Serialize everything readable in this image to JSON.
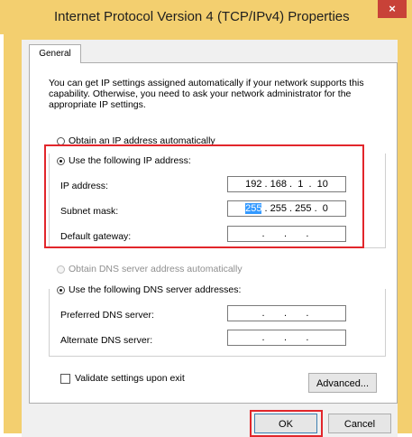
{
  "window": {
    "title": "Internet Protocol Version 4 (TCP/IPv4) Properties",
    "close_symbol": "×"
  },
  "tabs": [
    "General"
  ],
  "description": "You can get IP settings assigned automatically if your network supports this capability. Otherwise, you need to ask your network administrator for the appropriate IP settings.",
  "ip": {
    "auto_label": "Obtain an IP address automatically",
    "manual_label": "Use the following IP address:",
    "address_label": "IP address:",
    "address_value": "192 . 168 .  1  .  10",
    "mask_label": "Subnet mask:",
    "mask_selected": "255",
    "mask_rest": " . 255 . 255 .  0",
    "gateway_label": "Default gateway:",
    "gateway_value": " .       .       .  "
  },
  "dns": {
    "auto_label": "Obtain DNS server address automatically",
    "manual_label": "Use the following DNS server addresses:",
    "preferred_label": "Preferred DNS server:",
    "preferred_value": " .       .       .  ",
    "alternate_label": "Alternate DNS server:",
    "alternate_value": " .       .       .  "
  },
  "validate_label": "Validate settings upon exit",
  "buttons": {
    "advanced": "Advanced...",
    "ok": "OK",
    "cancel": "Cancel"
  },
  "colors": {
    "title_bar": "#f3cf6f",
    "highlight_box": "#e2262b",
    "close_button": "#c84238"
  }
}
